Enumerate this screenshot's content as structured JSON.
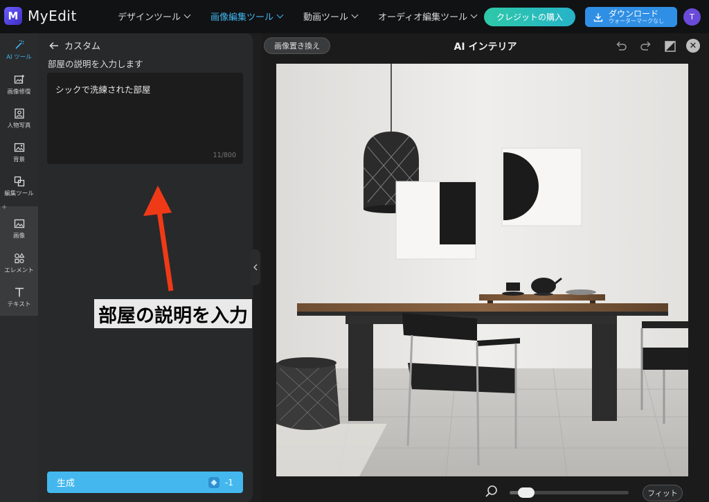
{
  "app": {
    "name": "MyEdit",
    "logo_letter": "M"
  },
  "nav": [
    {
      "label": "デザインツール",
      "active": false
    },
    {
      "label": "画像編集ツール",
      "active": true
    },
    {
      "label": "動画ツール",
      "active": false
    },
    {
      "label": "オーディオ編集ツール",
      "active": false
    }
  ],
  "header": {
    "credit_label": "クレジットの購入",
    "download_label": "ダウンロード",
    "download_sub": "ウォーターマークなし",
    "avatar_initial": "T"
  },
  "rail": [
    {
      "label": "AI ツール",
      "icon": "magic-wand-icon"
    },
    {
      "label": "画像修復",
      "icon": "image-repair-icon"
    },
    {
      "label": "人物写真",
      "icon": "portrait-icon"
    },
    {
      "label": "背景",
      "icon": "background-icon"
    },
    {
      "label": "編集ツール",
      "icon": "edit-tools-icon"
    },
    {
      "label": "画像",
      "icon": "image-icon"
    },
    {
      "label": "エレメント",
      "icon": "elements-icon"
    },
    {
      "label": "テキスト",
      "icon": "text-icon"
    }
  ],
  "rail_plus": "+",
  "panel": {
    "back_label": "カスタム",
    "prompt_label": "部屋の説明を入力します",
    "prompt_value": "シックで洗練された部屋",
    "char_count": "11/800",
    "generate_label": "生成",
    "generate_cost": "-1"
  },
  "annotation": {
    "text": "部屋の説明を入力",
    "color": "#f03a17"
  },
  "workspace": {
    "replace_label": "画像置き換え",
    "title": "AI インテリア",
    "fit_label": "フィット",
    "zoom_level": 0.08
  },
  "colors": {
    "accent": "#41b7f0",
    "credit": "#2ec9a8",
    "download": "#2f8fe4"
  }
}
